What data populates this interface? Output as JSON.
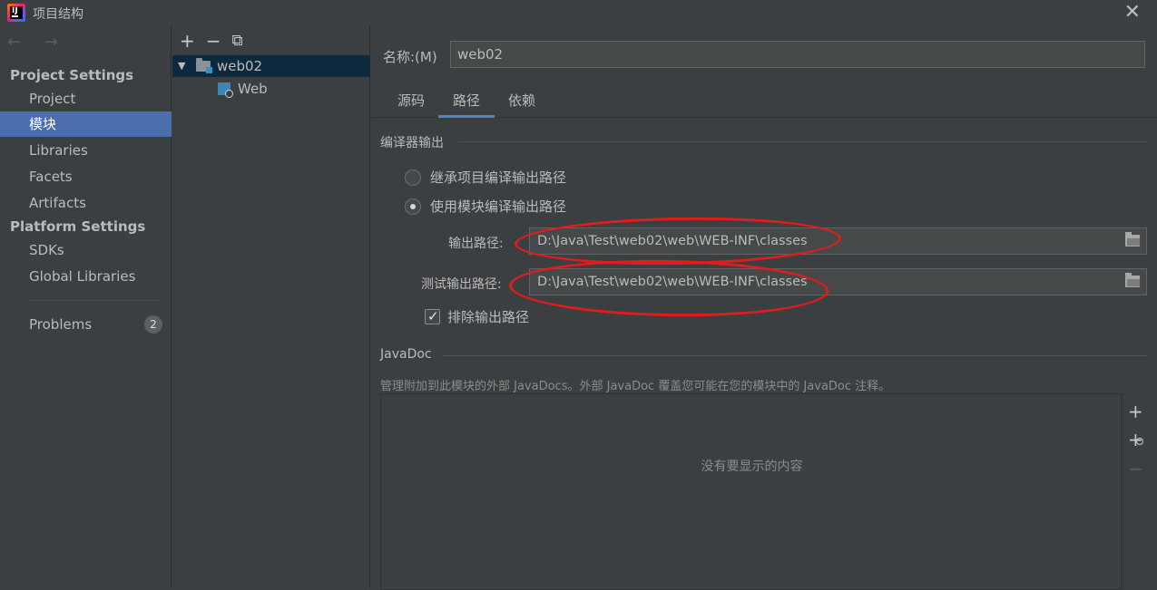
{
  "window": {
    "title": "项目结构",
    "close_glyph": "✕"
  },
  "nav": {
    "back_forward": "← →",
    "project_settings_title": "Project Settings",
    "project_settings_items": [
      "Project",
      "模块",
      "Libraries",
      "Facets",
      "Artifacts"
    ],
    "platform_settings_title": "Platform Settings",
    "platform_settings_items": [
      "SDKs",
      "Global Libraries"
    ],
    "problems_label": "Problems",
    "problems_count": "2",
    "selected_item": "模块"
  },
  "tree": {
    "toolbar": {
      "add": "+",
      "remove": "−",
      "copy": "⧉"
    },
    "module_name": "web02",
    "facet_name": "Web"
  },
  "module": {
    "name_label": "名称:(M)",
    "name_value": "web02",
    "tabs": [
      "源码",
      "路径",
      "依赖"
    ],
    "active_tab": "路径"
  },
  "paths": {
    "compiler_output_title": "编译器输出",
    "inherit_option": "继承项目编译输出路径",
    "use_module_option": "使用模块编译输出路径",
    "selected_option": "use_module",
    "output_path_label": "输出路径:",
    "output_path_value": "D:\\Java\\Test\\web02\\web\\WEB-INF\\classes",
    "test_output_path_label": "测试输出路径:",
    "test_output_path_value": "D:\\Java\\Test\\web02\\web\\WEB-INF\\classes",
    "exclude_output_label": "排除输出路径",
    "exclude_output_checked": true,
    "checkbox_tick": "✓"
  },
  "javadoc": {
    "title": "JavaDoc",
    "description": "管理附加到此模块的外部 JavaDocs。外部 JavaDoc 覆盖您可能在您的模块中的 JavaDoc 注释。",
    "empty_text": "没有要显示的内容",
    "tools": {
      "add": "+",
      "add_url": "+",
      "remove": "−"
    }
  },
  "colors": {
    "background": "#3c3f41",
    "selection": "#4b6eaf",
    "tree_selection": "#0d293e",
    "tab_underline": "#4a88c7",
    "annotation": "#e01c1c"
  }
}
